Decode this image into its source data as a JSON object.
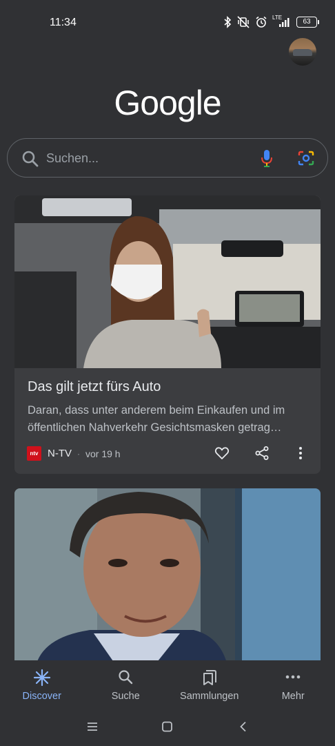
{
  "status_bar": {
    "time": "11:34",
    "network": "LTE",
    "battery": "63",
    "icons": [
      "bluetooth-icon",
      "vibrate-off-icon",
      "alarm-icon",
      "signal-icon",
      "battery-icon"
    ]
  },
  "logo_text": "Google",
  "search": {
    "placeholder": "Suchen..."
  },
  "cards": [
    {
      "title": "Das gilt jetzt fürs Auto",
      "snippet": "Daran, dass unter anderem beim Einkaufen und im öffentlichen Nahverkehr Gesichtsmasken getrag…",
      "source_logo": "ntv",
      "source": "N-TV",
      "separator": "·",
      "time": "vor 19 h"
    },
    {
      "title": "",
      "snippet": ""
    }
  ],
  "bottom_nav": [
    {
      "label": "Discover",
      "icon": "discover-icon",
      "active": true
    },
    {
      "label": "Suche",
      "icon": "search-icon",
      "active": false
    },
    {
      "label": "Sammlungen",
      "icon": "collections-icon",
      "active": false
    },
    {
      "label": "Mehr",
      "icon": "more-horizontal-icon",
      "active": false
    }
  ],
  "colors": {
    "background": "#303134",
    "card": "#3c3d40",
    "accent": "#8ab4f8",
    "ntv_red": "#d0111b"
  }
}
